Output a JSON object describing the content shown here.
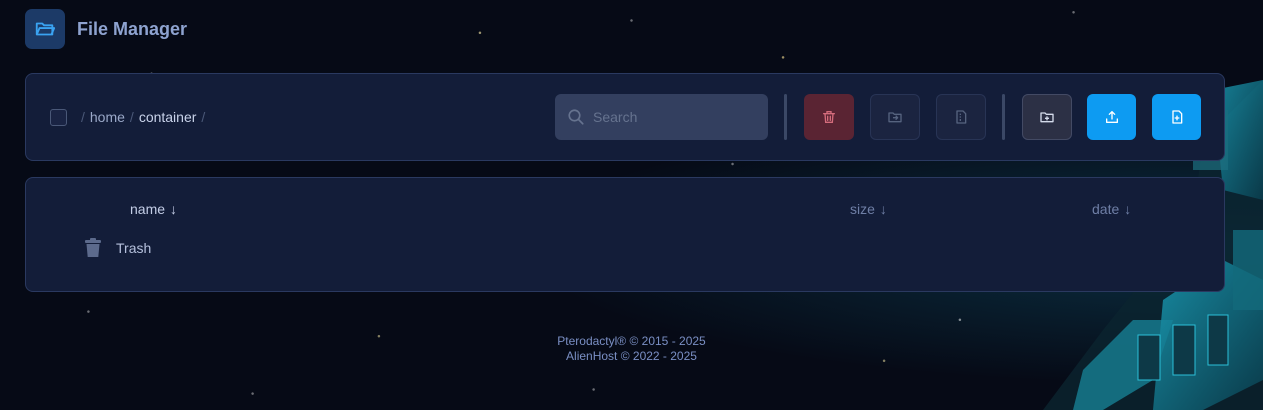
{
  "header": {
    "title": "File Manager",
    "icon": "folder-open-icon"
  },
  "toolbar": {
    "breadcrumb": {
      "separator": "/",
      "home": "home",
      "current": "container"
    },
    "search": {
      "placeholder": "Search",
      "value": ""
    },
    "buttons": [
      {
        "name": "delete",
        "icon": "trash-icon",
        "color": "#5a2433"
      },
      {
        "name": "move",
        "icon": "folder-move-icon",
        "color": "#1b2440"
      },
      {
        "name": "compress",
        "icon": "archive-file-icon",
        "color": "#1b2440"
      },
      {
        "name": "new-folder",
        "icon": "folder-plus-icon",
        "color": "#2c3045"
      },
      {
        "name": "upload",
        "icon": "upload-icon",
        "color": "#0d9bf2"
      },
      {
        "name": "new-file",
        "icon": "file-plus-icon",
        "color": "#0d9bf2"
      }
    ]
  },
  "files": {
    "columns": {
      "name": "name",
      "size": "size",
      "date": "date",
      "sort_arrow": "↓"
    },
    "rows": [
      {
        "name": "Trash",
        "icon": "trash-icon"
      }
    ]
  },
  "footer": {
    "line1": "Pterodactyl® © 2015 - 2025",
    "line2": "AlienHost © 2022 - 2025"
  },
  "colors": {
    "accent": "#0d9bf2",
    "panel": "#131d39",
    "danger": "#5a2433"
  }
}
